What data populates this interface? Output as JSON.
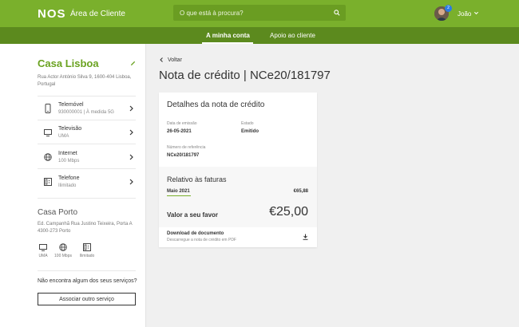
{
  "header": {
    "logo": "NOS",
    "portal_name": "Área de Cliente",
    "search_placeholder": "O que está à procura?",
    "notification_count": "2",
    "username": "João"
  },
  "nav": {
    "tabs": [
      {
        "label": "A minha conta",
        "active": true
      },
      {
        "label": "Apoio ao cliente",
        "active": false
      }
    ]
  },
  "sidebar": {
    "place": {
      "title": "Casa Lisboa",
      "address": "Rua Actor António Silva 9, 1600-404 Lisboa, Portugal",
      "services": [
        {
          "name": "Telemóvel",
          "detail": "930000001 | À medida 5G",
          "icon": "phone-icon"
        },
        {
          "name": "Televisão",
          "detail": "UMA",
          "icon": "tv-icon"
        },
        {
          "name": "Internet",
          "detail": "100 Mbps",
          "icon": "globe-icon"
        },
        {
          "name": "Telefone",
          "detail": "Ilimitado",
          "icon": "landline-icon"
        }
      ]
    },
    "place2": {
      "title": "Casa Porto",
      "address": "Ed. Campanhã Rua Justino Teixeira, Porta A 4300-273 Porto",
      "services": [
        {
          "label": "UMA",
          "icon": "tv-icon"
        },
        {
          "label": "100 Mbps",
          "icon": "globe-icon"
        },
        {
          "label": "Ilimitado",
          "icon": "landline-icon"
        }
      ]
    },
    "question": "Não encontra algum dos seus serviços?",
    "associate_button": "Associar outro serviço"
  },
  "main": {
    "back_label": "Voltar",
    "page_title": "Nota de crédito | NCe20/181797",
    "card": {
      "title": "Detalhes da nota de crédito",
      "emission_label": "Data de emissão",
      "emission_value": "26-05-2021",
      "status_label": "Estado",
      "status_value": "Emitido",
      "reference_label": "Número de referência",
      "reference_value": "NCe20/181797",
      "related_title": "Relativo às faturas",
      "invoice_month": "Maio 2021",
      "invoice_amount": "€65,88",
      "favor_label": "Valor a seu favor",
      "favor_amount": "€25,00",
      "download_title": "Download de documento",
      "download_sub": "Descarregue a nota de crédito em PDF"
    }
  },
  "colors": {
    "brand_green": "#7ab02c",
    "nav_green": "#5c8a1e",
    "accent_green": "#6aa220",
    "badge_blue": "#2b7be4"
  }
}
